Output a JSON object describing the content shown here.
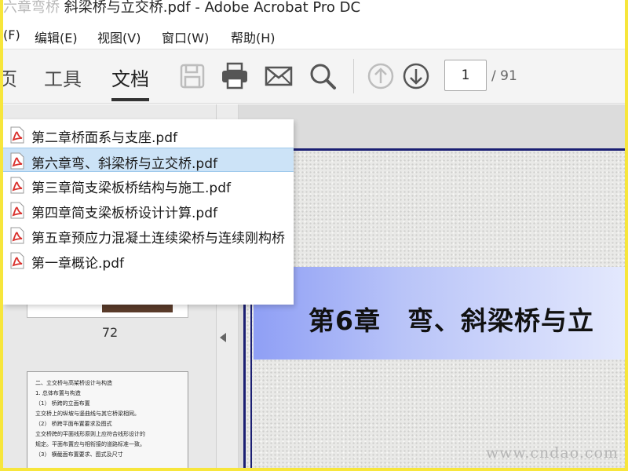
{
  "window": {
    "title_ghost": "六章弯桥",
    "title": " 斜梁桥与立交桥.pdf - Adobe Acrobat Pro DC"
  },
  "menubar": {
    "items": [
      "(F)",
      "编辑(E)",
      "视图(V)",
      "窗口(W)",
      "帮助(H)"
    ]
  },
  "toolbar": {
    "tabs": [
      "页",
      "工具",
      "文档"
    ],
    "active_tab": "文档",
    "page_input": "1",
    "page_total": "/ 91",
    "icons": [
      "save-icon",
      "print-icon",
      "email-icon",
      "search-icon",
      "page-up-icon",
      "page-down-icon"
    ]
  },
  "recent_files": {
    "items": [
      {
        "name": "第二章桥面系与支座.pdf",
        "selected": false
      },
      {
        "name": "第六章弯、斜梁桥与立交桥.pdf",
        "selected": true
      },
      {
        "name": "第三章简支梁板桥结构与施工.pdf",
        "selected": false
      },
      {
        "name": "第四章简支梁板桥设计计算.pdf",
        "selected": false
      },
      {
        "name": "第五章预应力混凝土连续梁桥与连续刚构桥",
        "selected": false
      },
      {
        "name": "第一章概论.pdf",
        "selected": false
      }
    ]
  },
  "sidebar": {
    "thumbnail_page_label": "72",
    "thumbnail_text": [
      "二、立交桥与高架桥设计与构造",
      "1.  总体布置与构造",
      "（1）  桥跨的立面布置",
      "    立交桥上的纵坡与竖曲线与其它桥梁相同。",
      "（2）  桥跨平面布置要求及图式",
      "    立交桥跨的平面线形原则上应符合线形设计的",
      "  规定。平面布置应与相衔接的道路标准一致。",
      "（3）  横截面布置要求、图式及尺寸"
    ]
  },
  "document": {
    "chapter_title": "第6章　弯、斜梁桥与立",
    "watermark": "www.cndao.com"
  },
  "colors": {
    "frame": "#f7e63b",
    "selection": "#cce3f7",
    "page_border": "#1b1f73",
    "pdf_red": "#d9302c"
  }
}
